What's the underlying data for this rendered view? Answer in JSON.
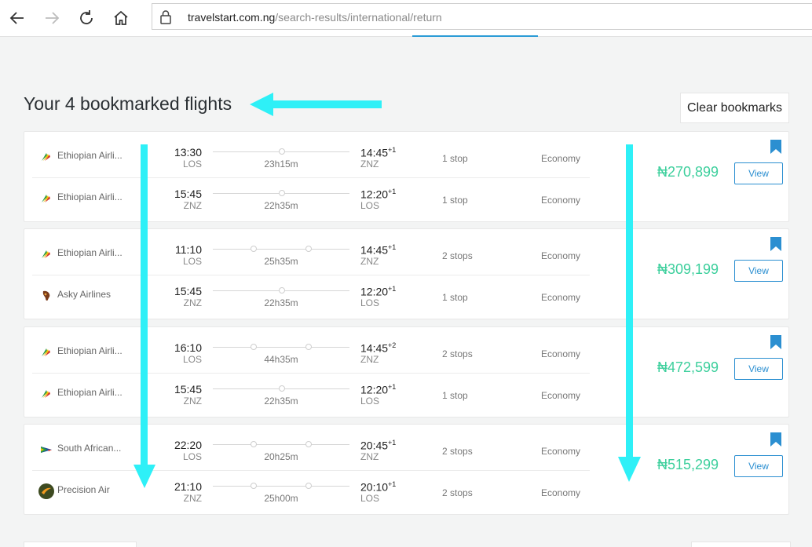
{
  "browser": {
    "url_host": "travelstart.com.ng",
    "url_path": "/search-results/international/return"
  },
  "page": {
    "title": "Your 4 bookmarked flights",
    "clear_label": "Clear bookmarks"
  },
  "colors": {
    "price": "#3ccf9c",
    "accent": "#2b8fd1",
    "annotation": "#2ef0f7"
  },
  "cards": [
    {
      "price": "₦270,899",
      "view_label": "View",
      "legs": [
        {
          "airline": "Ethiopian Airli...",
          "logo": "ethiopian-logo",
          "dep_time": "13:30",
          "dep_code": "LOS",
          "duration": "23h15m",
          "arr_time": "14:45",
          "arr_offset": "+1",
          "arr_code": "ZNZ",
          "stops": "1 stop",
          "cabin": "Economy"
        },
        {
          "airline": "Ethiopian Airli...",
          "logo": "ethiopian-logo",
          "dep_time": "15:45",
          "dep_code": "ZNZ",
          "duration": "22h35m",
          "arr_time": "12:20",
          "arr_offset": "+1",
          "arr_code": "LOS",
          "stops": "1 stop",
          "cabin": "Economy"
        }
      ]
    },
    {
      "price": "₦309,199",
      "view_label": "View",
      "legs": [
        {
          "airline": "Ethiopian Airli...",
          "logo": "ethiopian-logo",
          "dep_time": "11:10",
          "dep_code": "LOS",
          "duration": "25h35m",
          "arr_time": "14:45",
          "arr_offset": "+1",
          "arr_code": "ZNZ",
          "stops": "2 stops",
          "cabin": "Economy"
        },
        {
          "airline": "Asky Airlines",
          "logo": "asky-logo",
          "dep_time": "15:45",
          "dep_code": "ZNZ",
          "duration": "22h35m",
          "arr_time": "12:20",
          "arr_offset": "+1",
          "arr_code": "LOS",
          "stops": "1 stop",
          "cabin": "Economy"
        }
      ]
    },
    {
      "price": "₦472,599",
      "view_label": "View",
      "legs": [
        {
          "airline": "Ethiopian Airli...",
          "logo": "ethiopian-logo",
          "dep_time": "16:10",
          "dep_code": "LOS",
          "duration": "44h35m",
          "arr_time": "14:45",
          "arr_offset": "+2",
          "arr_code": "ZNZ",
          "stops": "2 stops",
          "cabin": "Economy"
        },
        {
          "airline": "Ethiopian Airli...",
          "logo": "ethiopian-logo",
          "dep_time": "15:45",
          "dep_code": "ZNZ",
          "duration": "22h35m",
          "arr_time": "12:20",
          "arr_offset": "+1",
          "arr_code": "LOS",
          "stops": "1 stop",
          "cabin": "Economy"
        }
      ]
    },
    {
      "price": "₦515,299",
      "view_label": "View",
      "legs": [
        {
          "airline": "South African...",
          "logo": "south-african-logo",
          "dep_time": "22:20",
          "dep_code": "LOS",
          "duration": "20h25m",
          "arr_time": "20:45",
          "arr_offset": "+1",
          "arr_code": "ZNZ",
          "stops": "2 stops",
          "cabin": "Economy"
        },
        {
          "airline": "Precision Air",
          "logo": "precision-air-logo",
          "dep_time": "21:10",
          "dep_code": "ZNZ",
          "duration": "25h00m",
          "arr_time": "20:10",
          "arr_offset": "+1",
          "arr_code": "LOS",
          "stops": "2 stops",
          "cabin": "Economy"
        }
      ]
    }
  ]
}
